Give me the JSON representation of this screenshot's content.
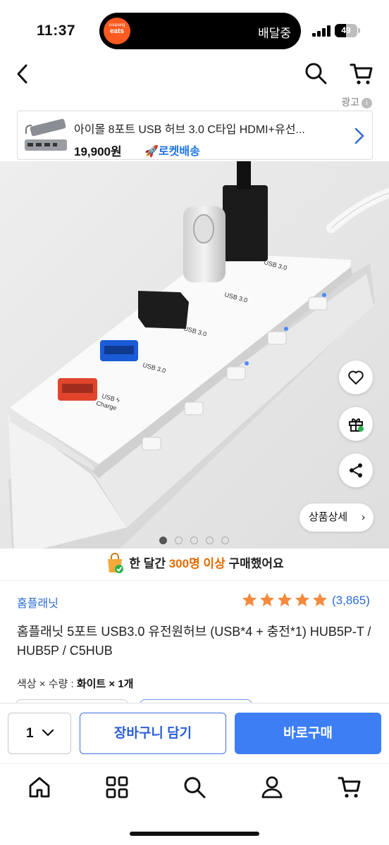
{
  "status": {
    "time": "11:37",
    "island_badge_small": "coupang",
    "island_badge_large": "eats",
    "island_text": "배달중",
    "battery": "49",
    "battery_level": 0.49
  },
  "ad": {
    "label": "광고",
    "info_glyph": "i",
    "title": "아이몰 8포트 USB 허브 3.0 C타입 HDMI+유선...",
    "price": "19,900원",
    "delivery_badge": "로켓배송",
    "rocket_icon": "🚀"
  },
  "hero": {
    "port_labels": [
      "USB 3.0",
      "USB 3.0",
      "USB 3.0",
      "USB 3.0"
    ],
    "charge_label_1": "USB ϟ",
    "charge_label_2": "Charge",
    "detail_button": "상품상세",
    "detail_arrow": "›",
    "image_count": 5,
    "current_image": 1
  },
  "social_proof": {
    "prefix": "한 달간 ",
    "highlight": "300명 이상",
    "suffix": " 구매했어요"
  },
  "product": {
    "brand": "홈플래닛",
    "rating": 5,
    "review_count": "(3,865)",
    "name": "홈플래닛 5포트 USB3.0 유전원허브 (USB*4 + 충전*1) HUB5P-T / HUB5P / C5HUB",
    "option_label": "색상 × 수량 : ",
    "option_value": "화이트 × 1개"
  },
  "purchase": {
    "quantity": "1",
    "add_to_cart": "장바구니 담기",
    "buy_now": "바로구매"
  },
  "colors": {
    "brand_blue": "#2b6bd6",
    "buy_blue": "#3d7ef5",
    "star_orange": "#f58a3c",
    "highlight_orange": "#e36b00"
  }
}
